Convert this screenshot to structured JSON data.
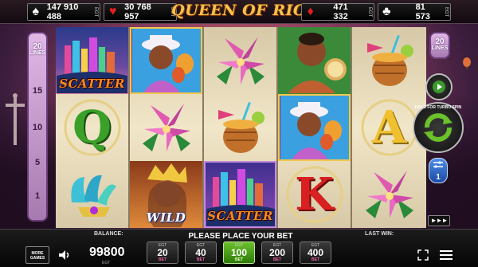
{
  "game": {
    "title": "QUEEN OF RIO"
  },
  "jackpots": [
    {
      "suit": "spade",
      "symbol": "♠",
      "color": "#ffffff",
      "amount": "147 910 488",
      "currency": "EGT"
    },
    {
      "suit": "heart",
      "symbol": "♥",
      "color": "#e02020",
      "amount": "30 768 957",
      "currency": "EGT"
    },
    {
      "suit": "diamond",
      "symbol": "♦",
      "color": "#e02020",
      "amount": "471 332",
      "currency": "EGT"
    },
    {
      "suit": "club",
      "symbol": "♣",
      "color": "#ffffff",
      "amount": "81 573",
      "currency": "EGT"
    }
  ],
  "lines": {
    "count": "20",
    "label": "LINES",
    "numbers": [
      "15",
      "10",
      "5",
      "1"
    ],
    "right_count": "20",
    "right_label": "LINES"
  },
  "reels": [
    [
      {
        "symbol": "scatter",
        "label": "SCATTER"
      },
      {
        "symbol": "Q",
        "label": "Q"
      },
      {
        "symbol": "feather-crown-icon"
      }
    ],
    [
      {
        "symbol": "man-with-maracas-icon"
      },
      {
        "symbol": "pink-flower-icon"
      },
      {
        "symbol": "wild",
        "label": "WILD"
      }
    ],
    [
      {
        "symbol": "pink-flower-icon"
      },
      {
        "symbol": "cocktail-icon"
      },
      {
        "symbol": "scatter",
        "label": "SCATTER"
      }
    ],
    [
      {
        "symbol": "drummer-man-icon"
      },
      {
        "symbol": "man-with-maracas-icon"
      },
      {
        "symbol": "K",
        "label": "K"
      }
    ],
    [
      {
        "symbol": "cocktail-icon"
      },
      {
        "symbol": "A",
        "label": "A"
      },
      {
        "symbol": "pink-flower-icon"
      }
    ]
  ],
  "controls": {
    "turbo_hint": "HOLD FOR TURBO SPIN",
    "autoplay_value": "1",
    "fast_forward": "►►►"
  },
  "bottom": {
    "balance_label": "BALANCE:",
    "balance_value": "99800",
    "balance_currency": "EGT",
    "message": "PLEASE PLACE YOUR BET",
    "last_win_label": "LAST WIN:",
    "more_games": "MORE GAMES",
    "bets": [
      {
        "currency": "EGT",
        "value": "20",
        "unit": "BET",
        "selected": false
      },
      {
        "currency": "EGT",
        "value": "40",
        "unit": "BET",
        "selected": false
      },
      {
        "currency": "EGT",
        "value": "100",
        "unit": "BET",
        "selected": true
      },
      {
        "currency": "EGT",
        "value": "200",
        "unit": "BET",
        "selected": false
      },
      {
        "currency": "EGT",
        "value": "400",
        "unit": "BET",
        "selected": false
      }
    ]
  },
  "colors": {
    "title_gold": "#f5c24a",
    "selected_bet_green": "#4f9f1a",
    "letter_q_green": "#3aa02a",
    "letter_a_gold": "#f0c030",
    "letter_k_red": "#d82020"
  }
}
